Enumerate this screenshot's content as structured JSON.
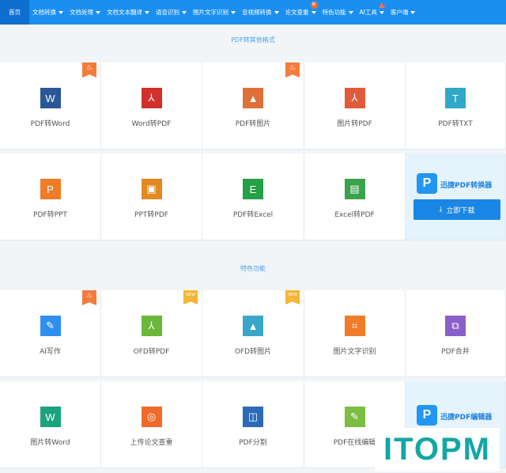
{
  "nav": {
    "items": [
      {
        "label": "首页",
        "caret": false,
        "badge": ""
      },
      {
        "label": "文档转换",
        "caret": true,
        "badge": ""
      },
      {
        "label": "文档处理",
        "caret": true,
        "badge": ""
      },
      {
        "label": "文档文本翻译",
        "caret": true,
        "badge": ""
      },
      {
        "label": "语音识别",
        "caret": true,
        "badge": ""
      },
      {
        "label": "图片文字识别",
        "caret": true,
        "badge": ""
      },
      {
        "label": "音视频转换",
        "caret": true,
        "badge": ""
      },
      {
        "label": "论文查重",
        "caret": true,
        "badge": "新"
      },
      {
        "label": "特色功能",
        "caret": true,
        "badge": ""
      },
      {
        "label": "AI工具",
        "caret": true,
        "badge": "hot"
      },
      {
        "label": "客户端",
        "caret": true,
        "badge": ""
      }
    ]
  },
  "section1": {
    "title": "PDF转其他格式",
    "cells": [
      {
        "label": "PDF转Word",
        "icon": "word-icon",
        "glyph": "W",
        "color": "#2b5797",
        "tag": "hot"
      },
      {
        "label": "Word转PDF",
        "icon": "pdf-icon",
        "glyph": "⅄",
        "color": "#d1312a",
        "tag": ""
      },
      {
        "label": "PDF转图片",
        "icon": "image-icon",
        "glyph": "▲",
        "color": "#e0703a",
        "tag": "hot"
      },
      {
        "label": "图片转PDF",
        "icon": "pdf-icon",
        "glyph": "⅄",
        "color": "#e05b3c",
        "tag": ""
      },
      {
        "label": "PDF转TXT",
        "icon": "txt-icon",
        "glyph": "T",
        "color": "#30a8c9",
        "tag": ""
      },
      {
        "label": "PDF转PPT",
        "icon": "ppt-icon",
        "glyph": "P",
        "color": "#f07b28",
        "tag": ""
      },
      {
        "label": "PPT转PDF",
        "icon": "ppt-pdf-icon",
        "glyph": "▣",
        "color": "#e08a21",
        "tag": ""
      },
      {
        "label": "PDF转Excel",
        "icon": "excel-icon",
        "glyph": "E",
        "color": "#24a146",
        "tag": ""
      },
      {
        "label": "Excel转PDF",
        "icon": "excel-pdf-icon",
        "glyph": "▤",
        "color": "#3ca24c",
        "tag": ""
      }
    ],
    "promo": {
      "brand": "迅捷PDF转换器",
      "logo": "P",
      "button": "立即下载",
      "button_icon": "download-icon"
    }
  },
  "section2": {
    "title": "特色功能",
    "cells": [
      {
        "label": "AI写作",
        "icon": "pen-icon",
        "glyph": "✎",
        "color": "#2f8ff0",
        "tag": "hot"
      },
      {
        "label": "OFD转PDF",
        "icon": "ofd-pdf-icon",
        "glyph": "⅄",
        "color": "#6ab83b",
        "tag": "new"
      },
      {
        "label": "OFD转图片",
        "icon": "ofd-image-icon",
        "glyph": "▲",
        "color": "#3aa7c9",
        "tag": "new"
      },
      {
        "label": "图片文字识别",
        "icon": "ocr-icon",
        "glyph": "⌗",
        "color": "#f07b28",
        "tag": ""
      },
      {
        "label": "PDF合并",
        "icon": "merge-icon",
        "glyph": "⧉",
        "color": "#8b5fc9",
        "tag": ""
      },
      {
        "label": "图片转Word",
        "icon": "word-icon",
        "glyph": "W",
        "color": "#1aa37f",
        "tag": ""
      },
      {
        "label": "上传论文查重",
        "icon": "scan-icon",
        "glyph": "◎",
        "color": "#f06a2a",
        "tag": ""
      },
      {
        "label": "PDF分割",
        "icon": "split-icon",
        "glyph": "◫",
        "color": "#2c6ab8",
        "tag": ""
      },
      {
        "label": "PDF在线编辑",
        "icon": "edit-icon",
        "glyph": "✎",
        "color": "#7cbd43",
        "tag": ""
      }
    ],
    "promo": {
      "brand": "迅捷PDF编辑器",
      "logo": "P"
    }
  },
  "tags": {
    "new": "NEW",
    "hot": "♨"
  },
  "watermark": "ITOPM"
}
